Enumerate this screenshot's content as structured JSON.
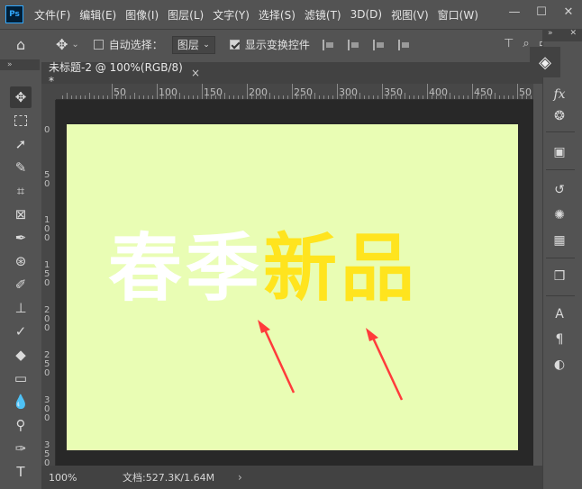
{
  "menubar": {
    "logo": "Ps",
    "items": [
      "文件(F)",
      "编辑(E)",
      "图像(I)",
      "图层(L)",
      "文字(Y)",
      "选择(S)",
      "滤镜(T)",
      "3D(D)",
      "视图(V)",
      "窗口(W)"
    ],
    "window_controls": [
      "—",
      "☐",
      "✕"
    ]
  },
  "options": {
    "auto_select_label": "自动选择：",
    "auto_select_checked": false,
    "target_value": "图层",
    "show_transform_label": "显示变换控件",
    "show_transform_checked": true
  },
  "panel_collapse": {
    "left": "»",
    "right": "»",
    "close": "✕"
  },
  "document": {
    "tab_title": "未标题-2 @ 100%(RGB/8) *",
    "close": "×",
    "canvas_color": "#e9fdb4"
  },
  "ruler": {
    "h_labels": [
      "50",
      "100",
      "150",
      "200",
      "250",
      "300",
      "350",
      "400",
      "450",
      "50"
    ],
    "v_labels": [
      "0",
      "50",
      "100",
      "150",
      "200",
      "250",
      "300",
      "350"
    ]
  },
  "headline": {
    "white_text": "春季",
    "yellow_text": "新品",
    "white_color": "#ffffff",
    "yellow_color": "#ffe41e"
  },
  "annotation": {
    "arrow_color": "#ff3b3b"
  },
  "status": {
    "zoom": "100%",
    "doc_size": "文档:527.3K/1.64M",
    "caret": "›"
  },
  "tools": [
    "move",
    "marquee",
    "lasso",
    "quick-select",
    "crop",
    "frame",
    "eyedropper",
    "healing",
    "brush",
    "stamp",
    "history-brush",
    "eraser",
    "gradient",
    "blur",
    "dodge",
    "pen",
    "type"
  ],
  "right_panels": [
    "layers",
    "fx",
    "adjustments",
    "libraries",
    "history",
    "paint",
    "swatches",
    "3d",
    "character",
    "paragraph",
    "contrast"
  ]
}
